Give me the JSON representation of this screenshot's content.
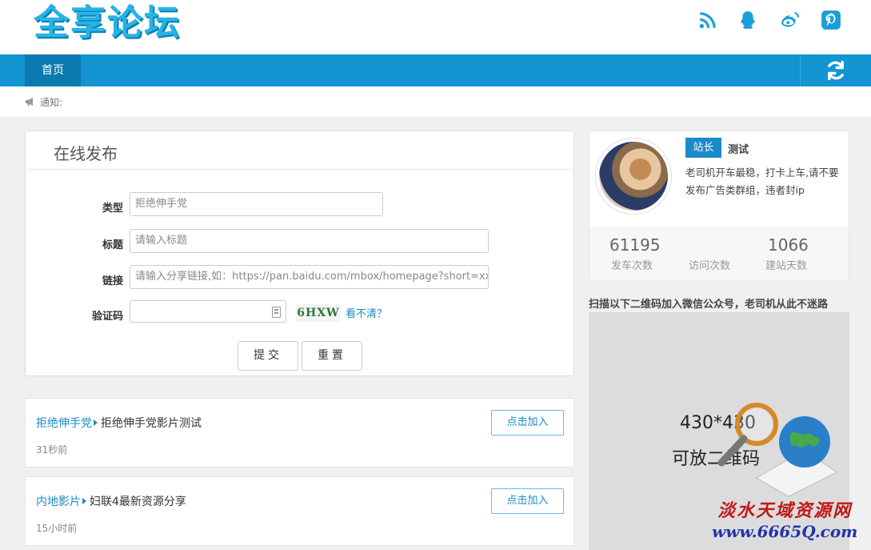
{
  "header": {
    "logo_text": "全享论坛",
    "social_icons": [
      "rss-icon",
      "qq-icon",
      "weibo-icon",
      "pinterest-icon"
    ]
  },
  "nav": {
    "home_label": "首页"
  },
  "notice": {
    "label": "通知:"
  },
  "post_form": {
    "title": "在线发布",
    "type_label": "类型",
    "type_value": "拒绝伸手党",
    "title_label": "标题",
    "title_placeholder": "请输入标题",
    "link_label": "链接",
    "link_placeholder": "请输入分享链接,如：https://pan.baidu.com/mbox/homepage?short=xxx",
    "captcha_label": "验证码",
    "captcha_text": "6HXW",
    "captcha_refresh": "看不清？",
    "submit_label": "提交",
    "reset_label": "重置"
  },
  "topics": [
    {
      "category": "拒绝伸手党",
      "title": "拒绝伸手党影片测试",
      "time": "31秒前",
      "join_label": "点击加入"
    },
    {
      "category": "内地影片",
      "title": "妇联4最新资源分享",
      "time": "15小时前",
      "join_label": "点击加入"
    }
  ],
  "profile": {
    "badge": "站长",
    "name": "测试",
    "description": "老司机开车最稳，打卡上车,请不要发布广告类群组，违者封ip",
    "stats": [
      {
        "value": "61195",
        "label": "发车次数"
      },
      {
        "value": "",
        "label": "访问次数"
      },
      {
        "value": "1066",
        "label": "建站天数"
      }
    ]
  },
  "qr": {
    "caption": "扫描以下二维码加入微信公众号，老司机从此不迷路",
    "size_text": "430*430",
    "hint_text": "可放二维码"
  },
  "watermark": {
    "cn": "淡水天域资源网",
    "url": "www.6665Q.com"
  },
  "colors": {
    "nav_blue": "#1295d1",
    "nav_active": "#0b7ab0",
    "link_blue": "#1a8bc8"
  }
}
